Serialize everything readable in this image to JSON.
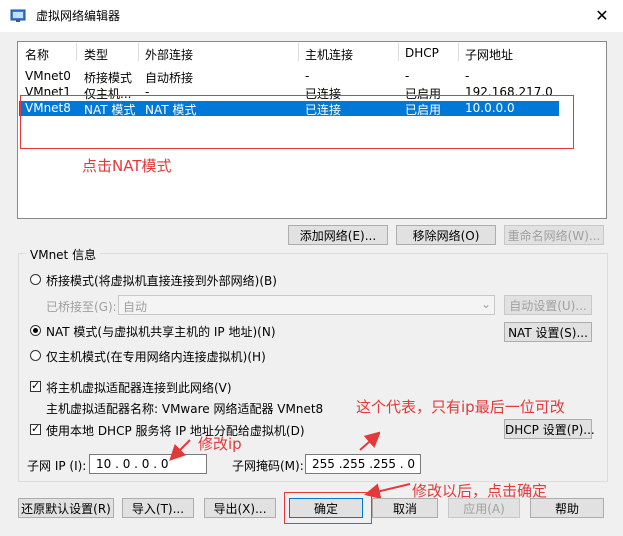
{
  "window": {
    "title": "虚拟网络编辑器",
    "close": "✕"
  },
  "table": {
    "headers": [
      "名称",
      "类型",
      "外部连接",
      "主机连接",
      "DHCP",
      "子网地址"
    ],
    "rows": [
      {
        "name": "VMnet0",
        "type": "桥接模式",
        "ext": "自动桥接",
        "host": "-",
        "dhcp": "-",
        "subnet": "-"
      },
      {
        "name": "VMnet1",
        "type": "仅主机...",
        "ext": "-",
        "host": "已连接",
        "dhcp": "已启用",
        "subnet": "192.168.217.0"
      },
      {
        "name": "VMnet8",
        "type": "NAT 模式",
        "ext": "NAT 模式",
        "host": "已连接",
        "dhcp": "已启用",
        "subnet": "10.0.0.0"
      }
    ]
  },
  "list_buttons": {
    "add": "添加网络(E)...",
    "remove": "移除网络(O)",
    "rename": "重命名网络(W)..."
  },
  "vmnet": {
    "group_title": "VMnet 信息",
    "bridge_label": "桥接模式(将虚拟机直接连接到外部网络)(B)",
    "bridged_to_label": "已桥接至(G):",
    "bridged_to_value": "自动",
    "auto_settings": "自动设置(U)...",
    "nat_label": "NAT 模式(与虚拟机共享主机的 IP 地址)(N)",
    "nat_settings": "NAT 设置(S)...",
    "hostonly_label": "仅主机模式(在专用网络内连接虚拟机)(H)",
    "connect_adapter_label": "将主机虚拟适配器连接到此网络(V)",
    "adapter_name": "主机虚拟适配器名称: VMware 网络适配器 VMnet8",
    "dhcp_label": "使用本地 DHCP 服务将 IP 地址分配给虚拟机(D)",
    "dhcp_settings": "DHCP 设置(P)...",
    "subnet_ip_label": "子网 IP (I):",
    "subnet_ip": "10 . 0 . 0 . 0",
    "mask_label": "子网掩码(M):",
    "mask": "255 .255 .255 . 0"
  },
  "bottom": {
    "restore": "还原默认设置(R)",
    "import": "导入(T)...",
    "export": "导出(X)...",
    "ok": "确定",
    "cancel": "取消",
    "apply": "应用(A)",
    "help": "帮助"
  },
  "annotations": {
    "click_nat": "点击NAT模式",
    "note_last": "这个代表，只有ip最后一位可改",
    "modify_ip": "修改ip",
    "after_modify": "修改以后，点击确定"
  },
  "colors": {
    "accent": "#0078d7",
    "annotation": "#e23a3a"
  }
}
